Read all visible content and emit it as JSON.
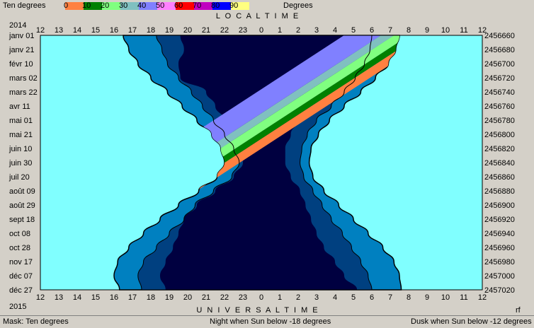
{
  "legend": {
    "title": "Ten degrees",
    "unit_label": "Degrees",
    "stops": [
      {
        "label": "0",
        "color": "#ff8040"
      },
      {
        "label": "10",
        "color": "#008000"
      },
      {
        "label": "20",
        "color": "#80ff80"
      },
      {
        "label": "30",
        "color": "#80c0c0"
      },
      {
        "label": "40",
        "color": "#8080ff"
      },
      {
        "label": "50",
        "color": "#ff80ff"
      },
      {
        "label": "60",
        "color": "#ff0000"
      },
      {
        "label": "70",
        "color": "#c000c0"
      },
      {
        "label": "80",
        "color": "#0000ff"
      },
      {
        "label": "90",
        "color": "#ffff80"
      }
    ]
  },
  "top_title": "L O C A L     T I M E",
  "bottom_title": "U N I V E R S A L     T I M E",
  "year_top": "2014",
  "year_bottom": "2015",
  "corner_label": "rf",
  "status": {
    "mask": "Mask:  Ten degrees",
    "night": "Night when Sun below -18 degrees",
    "dusk": "Dusk when Sun below -12 degrees"
  },
  "colors": {
    "day": "#80ffff",
    "night": "#000040",
    "astro": "#004080",
    "civil": "#0080c0"
  },
  "chart_data": {
    "type": "heatmap",
    "x_hours": [
      "12",
      "13",
      "14",
      "15",
      "16",
      "17",
      "18",
      "19",
      "20",
      "21",
      "22",
      "23",
      "0",
      "1",
      "2",
      "3",
      "4",
      "5",
      "6",
      "7",
      "8",
      "9",
      "10",
      "11",
      "12"
    ],
    "date_labels": [
      "janv 01",
      "janv 21",
      "févr 10",
      "mars 02",
      "mars 22",
      "avr 11",
      "mai 01",
      "mai 21",
      "juin 10",
      "juin 30",
      "juil 20",
      "août 09",
      "août 29",
      "sept 18",
      "oct 08",
      "oct 28",
      "nov 17",
      "déc 07",
      "déc 27"
    ],
    "jd_labels": [
      "2456660",
      "2456680",
      "2456700",
      "2456720",
      "2456740",
      "2456760",
      "2456780",
      "2456800",
      "2456820",
      "2456840",
      "2456860",
      "2456880",
      "2456900",
      "2456920",
      "2456940",
      "2456960",
      "2456980",
      "2457000",
      "2457020"
    ],
    "night_start_hour": [
      19.6,
      19.8,
      19.5,
      19.6,
      21.0,
      21.5,
      22.0,
      22.5,
      22.8,
      23.0,
      22.5,
      21.5,
      20.5,
      19.8,
      19.5,
      19.2,
      18.8,
      18.5,
      18.8
    ],
    "night_end_hour": [
      5.2,
      5.0,
      4.5,
      4.0,
      3.4,
      2.7,
      2.0,
      1.6,
      1.3,
      1.3,
      1.6,
      2.1,
      2.4,
      2.7,
      3.0,
      3.4,
      4.0,
      4.5,
      5.2
    ],
    "dusk_start_hour": [
      18.3,
      18.6,
      18.9,
      19.5,
      20.2,
      20.8,
      21.4,
      22.0,
      22.5,
      22.8,
      22.4,
      21.4,
      20.4,
      19.8,
      19.0,
      18.3,
      17.6,
      17.3,
      17.5
    ],
    "dusk_end_hour": [
      6.0,
      5.9,
      5.6,
      5.1,
      4.5,
      3.8,
      3.0,
      2.5,
      2.2,
      2.1,
      2.3,
      2.8,
      3.3,
      3.8,
      4.4,
      4.9,
      5.4,
      5.8,
      6.0
    ],
    "day_start_hour": [
      16.5,
      16.8,
      17.3,
      18.0,
      18.9,
      19.7,
      20.5,
      21.3,
      21.8,
      22.0,
      21.6,
      20.6,
      19.5,
      18.5,
      17.6,
      16.8,
      16.2,
      16.0,
      16.3
    ],
    "day_end_hour": [
      7.5,
      7.3,
      6.9,
      6.2,
      5.4,
      4.5,
      3.7,
      3.1,
      2.7,
      2.6,
      2.8,
      3.4,
      4.2,
      5.0,
      5.8,
      6.6,
      7.2,
      7.5,
      7.6
    ],
    "band_values": [
      "0",
      "10",
      "20",
      "30",
      "40"
    ]
  }
}
